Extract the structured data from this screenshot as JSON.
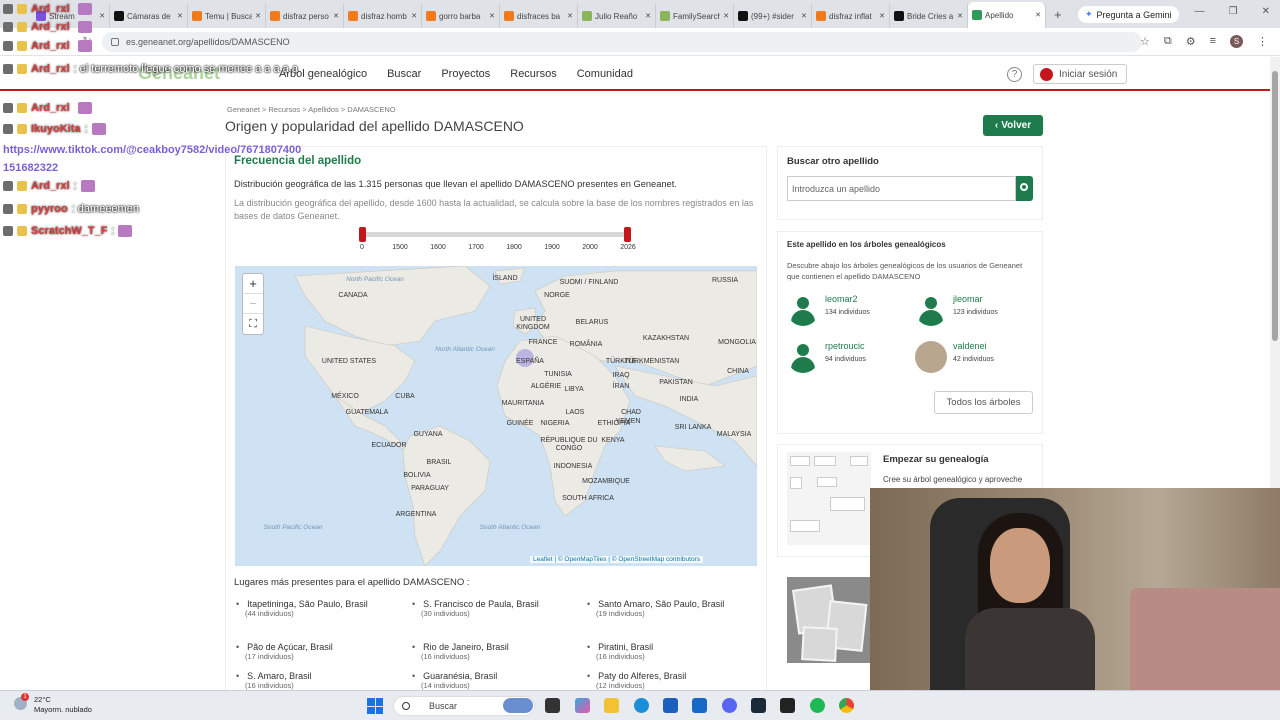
{
  "browser": {
    "tabs": [
      {
        "label": "Stream",
        "color": "#7b4fe0"
      },
      {
        "label": "Cámaras de",
        "color": "#111111"
      },
      {
        "label": "Temu | Busca",
        "color": "#f27a1a"
      },
      {
        "label": "disfraz perso",
        "color": "#f27a1a"
      },
      {
        "label": "disfraz homb",
        "color": "#f27a1a"
      },
      {
        "label": "gorro barba",
        "color": "#f27a1a"
      },
      {
        "label": "disfraces ba",
        "color": "#f27a1a"
      },
      {
        "label": "Julio Reaño",
        "color": "#8bb55a"
      },
      {
        "label": "FamilySearch",
        "color": "#8bb55a"
      },
      {
        "label": "(99+) #sider",
        "color": "#111111"
      },
      {
        "label": "disfraz inflat",
        "color": "#f27a1a"
      },
      {
        "label": "Bride Cries a",
        "color": "#111111"
      },
      {
        "label": "Apellido",
        "color": "#2f9a5c"
      }
    ],
    "gemini_label": "Pregunta a Gemini",
    "url": "es.geneanet.org/apellidos/DAMASCENO",
    "profile_initial": "S"
  },
  "site": {
    "logo": "Geneanet",
    "nav": [
      "Árbol genealógico",
      "Buscar",
      "Proyectos",
      "Recursos",
      "Comunidad"
    ],
    "help": "?",
    "login": "Iniciar sesión"
  },
  "page": {
    "breadcrumb": "Geneanet > Recursos > Apellidos > DAMASCENO",
    "title": "Origen y popularidad del apellido DAMASCENO",
    "back_button": "Volver",
    "freq_title": "Frecuencia del apellido",
    "desc1": "Distribución geográfica de las 1.315 personas que llevan el apellido DAMASCENO presentes en Geneanet.",
    "desc2": "La distribución geográfica del apellido, desde 1600 hasta la actualidad, se calcula sobre la base de los nombres registrados en las bases de datos Geneanet.",
    "slider": {
      "ticks": [
        "0",
        "1500",
        "1600",
        "1700",
        "1800",
        "1900",
        "2000",
        "2026"
      ],
      "range_start": "0",
      "range_end": "2026"
    },
    "map": {
      "zoom_in": "+",
      "zoom_out": "−",
      "fullscreen": "⛶",
      "attribution": "Leaflet | © OpenMapTiles | © OpenStreetMap contributors",
      "countries": [
        "CANADA",
        "ÍSLAND",
        "SUOMI / FINLAND",
        "NORGE",
        "RUSSIA",
        "UNITED KINGDOM",
        "BELARUS",
        "FRANCE",
        "ROMÂNIA",
        "KAZAKHSTAN",
        "MONGOLIA",
        "UNITED STATES",
        "ESPAÑA",
        "TÜRKIYE",
        "TÜRKMENISTAN",
        "TUNISIA",
        "IRAQ",
        "ALGÉRIE",
        "LIBYA",
        "CHINA",
        "MÉXICO",
        "CUBA",
        "ÍRAN",
        "PAKISTAN",
        "GUATEMALA",
        "MAURITANIA",
        "INDIA",
        "LAOS",
        "CHAD",
        "YEMEN",
        "GUYANA",
        "GUINÉE",
        "NIGERIA",
        "ETHIOPIA",
        "SRI LANKA",
        "MALAYSIA",
        "ECUADOR",
        "RÉPUBLIQUE DU CONGO",
        "KENYA",
        "BRASIL",
        "INDONESIA",
        "BOLIVIA",
        "PARAGUAY",
        "MOZAMBIQUE",
        "SOUTH AFRICA",
        "ARGENTINA"
      ],
      "oceans": [
        "North Atlantic Ocean",
        "South Atlantic Ocean",
        "South Pacific Ocean",
        "North Pacific Ocean",
        "South Atlantic Ocean"
      ]
    },
    "places_title": "Lugares más presentes para el apellido DAMASCENO :",
    "places": [
      {
        "name": "Itapetininga, São Paulo, Brasil",
        "count": "(44 individuos)"
      },
      {
        "name": "S. Francisco de Paula, Brasil",
        "count": "(30 individuos)"
      },
      {
        "name": "Santo Amaro, São Paulo, Brasil",
        "count": "(19 individuos)"
      },
      {
        "name": "Pão de Açúcar, Brasil",
        "count": "(17 individuos)"
      },
      {
        "name": "Rio de Janeiro, Brasil",
        "count": "(16 individuos)"
      },
      {
        "name": "Piratini, Brasil",
        "count": "(16 individuos)"
      },
      {
        "name": "S. Amaro, Brasil",
        "count": "(16 individuos)"
      },
      {
        "name": "Guaranésia, Brasil",
        "count": "(14 individuos)"
      },
      {
        "name": "Paty do Alferes, Brasil",
        "count": "(12 individuos)"
      }
    ]
  },
  "sidebar": {
    "search_title": "Buscar otro apellido",
    "search_placeholder": "Introduzca un apellido",
    "trees_title": "Este apellido en los árboles genealógicos",
    "trees_desc": "Descubre abajo los árboles genealógicos de los usuarios de Geneanet que contienen el apellido DAMASCENO",
    "trees": [
      {
        "user": "leomar2",
        "count": "134 individuos"
      },
      {
        "user": "jleomar",
        "count": "123 individuos"
      },
      {
        "user": "rpetroucic",
        "count": "94 individuos"
      },
      {
        "user": "valdenei",
        "count": "42 individuos"
      }
    ],
    "all_trees": "Todos los árboles",
    "start_title": "Empezar su genealogía",
    "start_desc": "Cree su árbol genealógico y aproveche"
  },
  "chat": [
    {
      "user": "Ard_rxl",
      "msg": ""
    },
    {
      "user": "Ard_rxl",
      "msg": ""
    },
    {
      "user": "Ard_rxl",
      "msg": ""
    },
    {
      "user": "Ard_rxl",
      "msg": ": el terremoto llegue como se menee a a a a a"
    },
    {
      "user": "Ard_rxl",
      "msg": ""
    },
    {
      "user": "IkuyoKita",
      "msg": ":"
    },
    {
      "user": "",
      "msg": "https://www.tiktok.com/@ceakboy7582/video/7671807400 151682322"
    },
    {
      "user": "Ard_rxl",
      "msg": ":"
    },
    {
      "user": "pyyroo",
      "msg": ": dameeemen"
    },
    {
      "user": "ScratchW_T_F",
      "msg": ":"
    }
  ],
  "taskbar": {
    "temp": "22°C",
    "weather": "Mayorm. nublado",
    "notif": "1",
    "search": "Buscar"
  }
}
